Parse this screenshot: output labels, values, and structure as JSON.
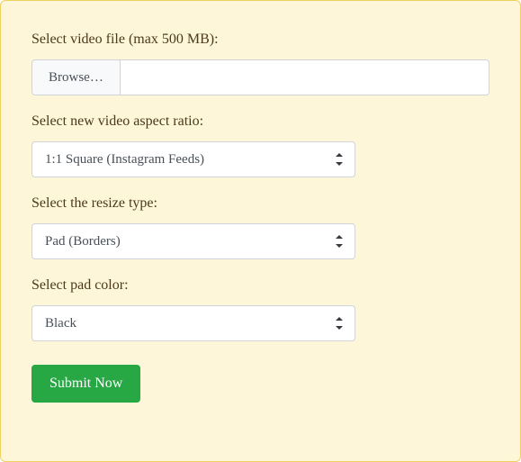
{
  "fileField": {
    "label": "Select video file (max 500 MB):",
    "browseLabel": "Browse…",
    "value": ""
  },
  "aspectRatio": {
    "label": "Select new video aspect ratio:",
    "value": "1:1 Square (Instagram Feeds)"
  },
  "resizeType": {
    "label": "Select the resize type:",
    "value": "Pad (Borders)"
  },
  "padColor": {
    "label": "Select pad color:",
    "value": "Black"
  },
  "submit": {
    "label": "Submit Now"
  }
}
